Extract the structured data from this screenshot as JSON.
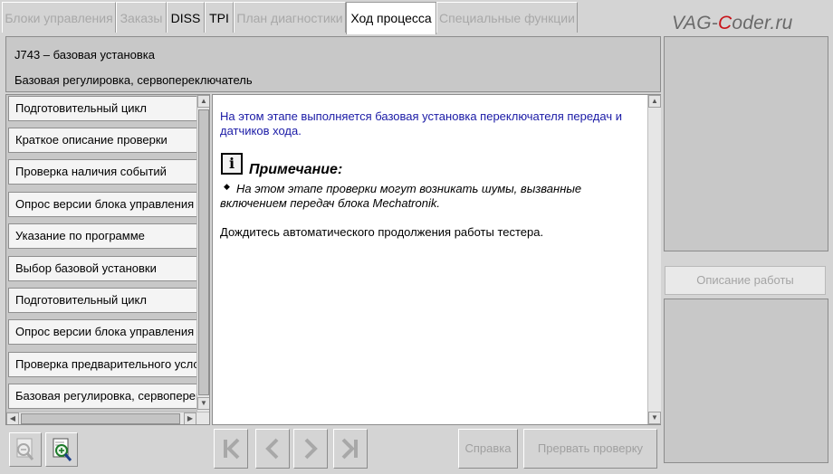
{
  "tabs": [
    {
      "label": "Блоки управления",
      "state": "disabled"
    },
    {
      "label": "Заказы",
      "state": "disabled"
    },
    {
      "label": "DISS",
      "state": "enabled"
    },
    {
      "label": "TPI",
      "state": "enabled"
    },
    {
      "label": "План диагностики",
      "state": "disabled"
    },
    {
      "label": "Ход процесса",
      "state": "active"
    },
    {
      "label": "Специальные функции",
      "state": "disabled"
    }
  ],
  "watermark": {
    "part1": "VAG-",
    "part2": "C",
    "part3": "oder.ru"
  },
  "header": {
    "line1": "J743 – базовая установка",
    "line2": "Базовая регулировка, сервопереключатель"
  },
  "steps": [
    "Подготовительный цикл",
    "Краткое описание проверки",
    "Проверка наличия событий",
    "Опрос версии блока управления",
    "Указание по программе",
    "Выбор базовой установки",
    "Подготовительный цикл",
    "Опрос версии блока управления",
    "Проверка предварительного условия",
    "Базовая регулировка, сервопереключатель"
  ],
  "content": {
    "intro": "На этом этапе выполняется базовая установка переключателя передач и датчиков хода.",
    "note_title": "Примечание:",
    "note_text": "На этом этапе проверки могут возникать шумы, вызванные включением передач блока Mechatronik.",
    "outro": "Дождитесь автоматического продолжения работы тестера."
  },
  "right": {
    "description_button": "Описание работы"
  },
  "toolbar": {
    "help": "Справка",
    "abort": "Прервать проверку"
  },
  "icons": {
    "zoom_out": "zoom-out-icon",
    "zoom_in": "zoom-in-icon",
    "first": "skip-first-icon",
    "prev": "chevron-left-icon",
    "next": "chevron-right-icon",
    "last": "skip-last-icon",
    "info": "info-icon",
    "bullet": "bullet-icon"
  }
}
